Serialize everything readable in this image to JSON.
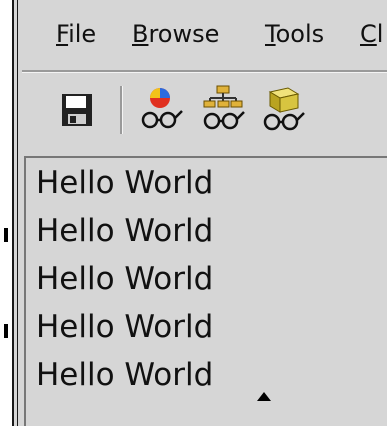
{
  "menubar": {
    "items": [
      {
        "mnemonic": "F",
        "rest": "ile"
      },
      {
        "mnemonic": "B",
        "rest": "rowse"
      },
      {
        "mnemonic": "T",
        "rest": "ools"
      },
      {
        "mnemonic": "C",
        "rest": "l"
      }
    ]
  },
  "toolbar": {
    "buttons": [
      {
        "icon": "save-icon"
      },
      {
        "icon": "browse-objects-icon"
      },
      {
        "icon": "browse-hierarchy-icon"
      },
      {
        "icon": "browse-package-icon"
      }
    ]
  },
  "content": {
    "lines": [
      "Hello World",
      "Hello World",
      "Hello World",
      "Hello World",
      "Hello World"
    ]
  }
}
